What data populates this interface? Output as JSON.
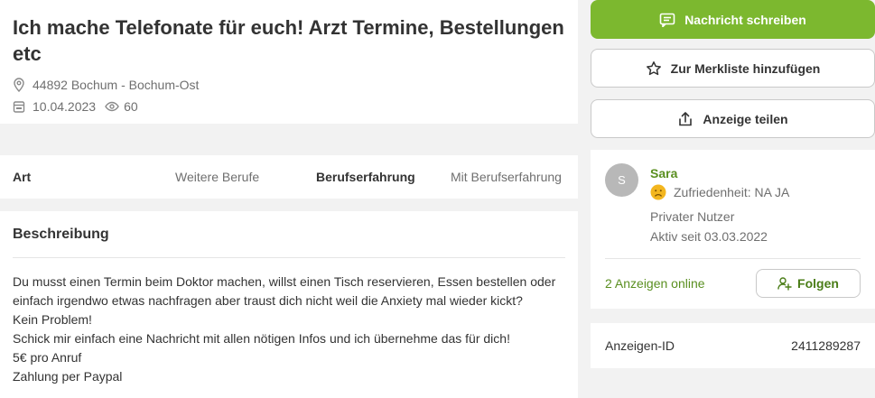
{
  "listing": {
    "title": "Ich mache Telefonate für euch! Arzt Termine, Bestellungen etc",
    "location": "44892 Bochum - Bochum-Ost",
    "date": "10.04.2023",
    "views": "60"
  },
  "details": {
    "art_label": "Art",
    "art_value": "Weitere Berufe",
    "exp_label": "Berufserfahrung",
    "exp_value": "Mit Berufserfahrung"
  },
  "description": {
    "heading": "Beschreibung",
    "lines": [
      "Du musst einen Termin beim Doktor machen, willst einen Tisch reservieren, Essen bestellen oder",
      "einfach irgendwo etwas nachfragen aber traust dich nicht weil die Anxiety mal wieder kickt?",
      "Kein Problem!",
      "Schick mir einfach eine Nachricht mit allen nötigen Infos und ich übernehme das für dich!",
      "5€ pro Anruf",
      "Zahlung per Paypal"
    ]
  },
  "actions": {
    "message": "Nachricht schreiben",
    "watchlist": "Zur Merkliste hinzufügen",
    "share": "Anzeige teilen"
  },
  "seller": {
    "initial": "S",
    "name": "Sara",
    "satisfaction": "Zufriedenheit: NA JA",
    "type": "Privater Nutzer",
    "active_since": "Aktiv seit 03.03.2022",
    "ads_online": "2 Anzeigen online",
    "follow": "Folgen"
  },
  "ad_id": {
    "label": "Anzeigen-ID",
    "value": "2411289287"
  },
  "colors": {
    "primary_green": "#7cb82f",
    "link_green": "#5a8f20",
    "sad_face": "#f3b61f"
  },
  "icons": {
    "location": "location-pin-icon",
    "calendar": "calendar-icon",
    "views": "eye-icon",
    "message": "message-icon",
    "star": "star-icon",
    "share": "share-icon",
    "satisfaction": "sad-face-icon",
    "follow": "follow-user-icon"
  }
}
